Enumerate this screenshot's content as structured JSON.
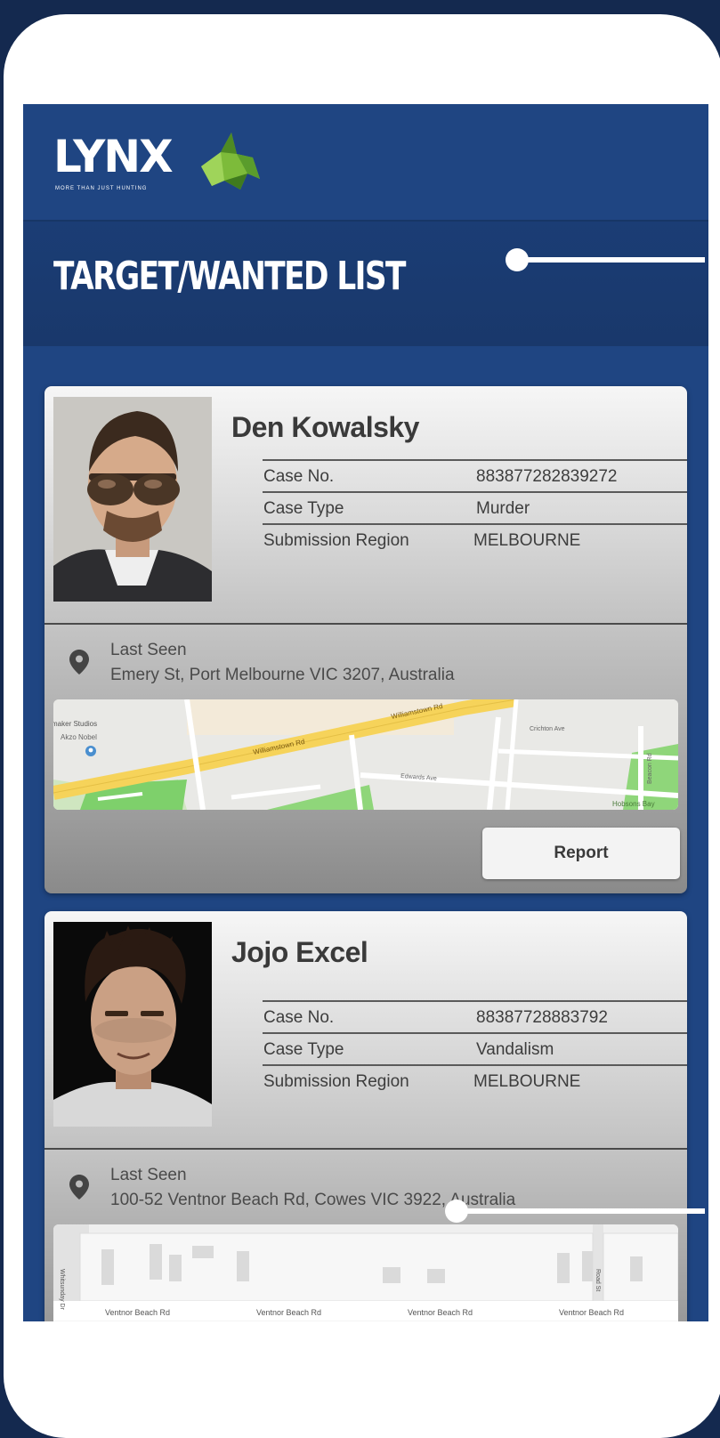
{
  "app": {
    "logo_text": "LYNX",
    "logo_tagline": "MORE THAN JUST HUNTING"
  },
  "page": {
    "title": "TARGET/WANTED LIST"
  },
  "labels": {
    "case_no": "Case No.",
    "case_type": "Case Type",
    "submission_region": "Submission Region",
    "last_seen": "Last Seen",
    "report": "Report"
  },
  "targets": [
    {
      "name": "Den Kowalsky",
      "case_no": "883877282839272",
      "case_type": "Murder",
      "submission_region": "MELBOURNE",
      "last_seen_address": "Emery St, Port Melbourne VIC 3207, Australia",
      "map_labels": {
        "poi_1": "maker Studios",
        "poi_2": "Akzo Nobel",
        "road_main": "Williamstown Rd",
        "road_main_2": "Williamstown Rd",
        "road_2": "Edwards Ave",
        "road_3": "Beacon Rd",
        "road_4": "Crichton Ave",
        "park": "Hobsons Bay"
      }
    },
    {
      "name": "Jojo Excel",
      "case_no": "88387728883792",
      "case_type": "Vandalism",
      "submission_region": "MELBOURNE",
      "last_seen_address": "100-52 Ventnor Beach Rd, Cowes VIC 3922, Australia",
      "map_labels": {
        "road_1": "Ventnor Beach Rd",
        "road_2": "Ventnor Beach Rd",
        "road_3": "Ventnor Beach Rd",
        "road_4": "Ventnor Beach Rd",
        "side_road": "Whitsunday Dr",
        "side_road_2": "Road St"
      }
    }
  ],
  "colors": {
    "outer_background": "#14294f",
    "app_background": "#1f4582",
    "logo_green": "#7dbb3a"
  }
}
